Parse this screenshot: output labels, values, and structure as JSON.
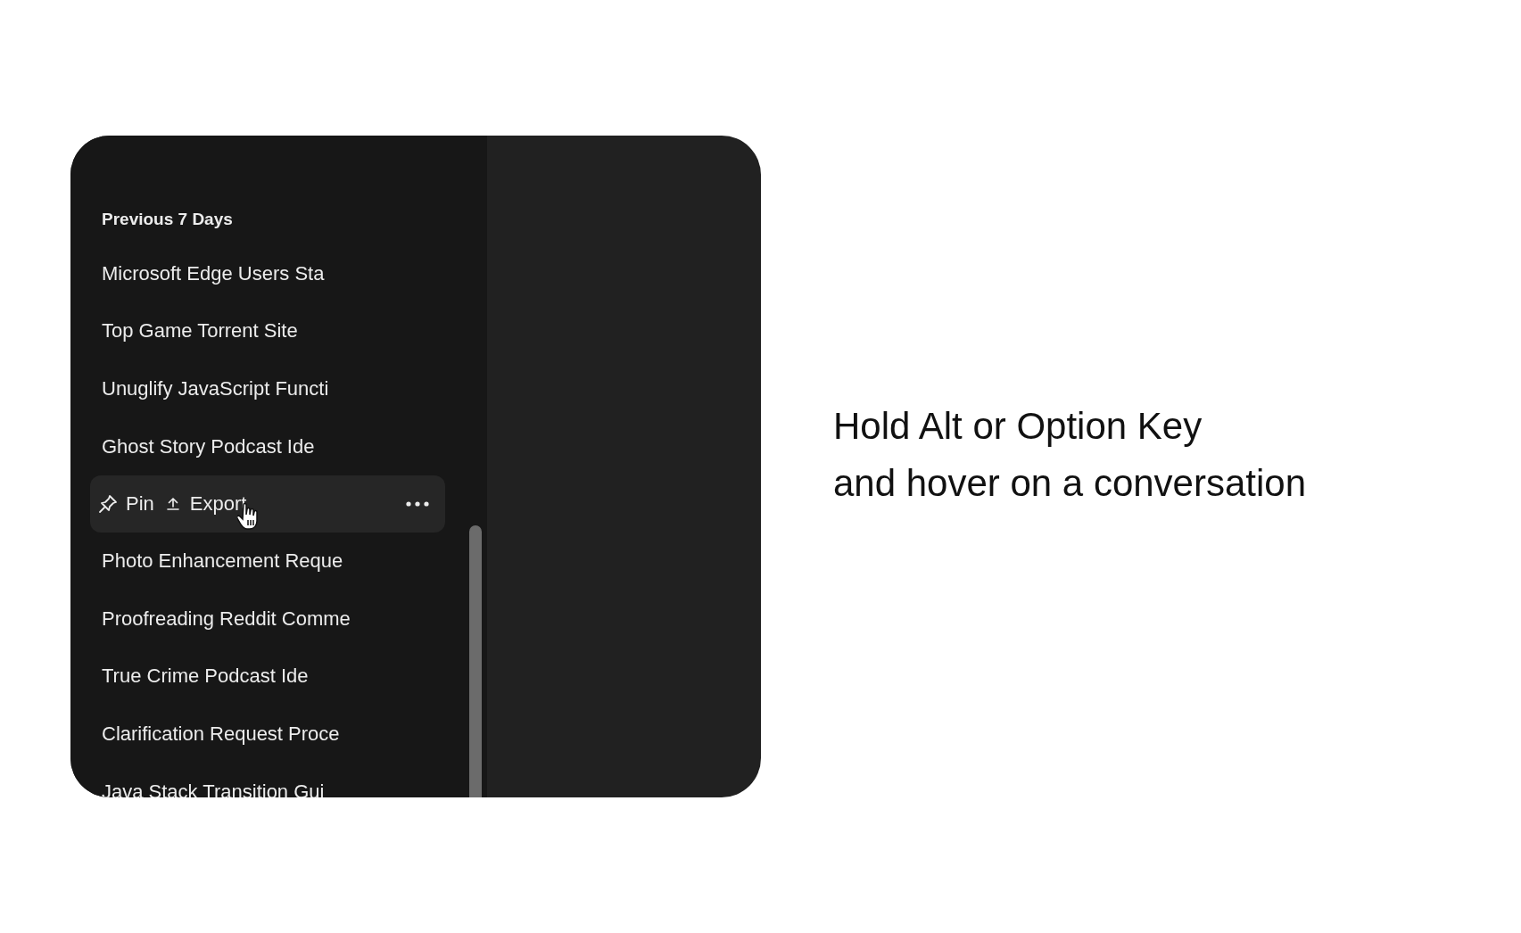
{
  "sidebar": {
    "section_heading": "Previous 7 Days",
    "items": [
      {
        "kind": "title",
        "title": "Microsoft Edge Users Sta"
      },
      {
        "kind": "title",
        "title": "Top Game Torrent Site"
      },
      {
        "kind": "title",
        "title": "Unuglify JavaScript Functi"
      },
      {
        "kind": "title",
        "title": "Ghost Story Podcast Ide"
      },
      {
        "kind": "actions",
        "pin": "Pin",
        "export": "Export"
      },
      {
        "kind": "title",
        "title": "Photo Enhancement Reque"
      },
      {
        "kind": "title",
        "title": "Proofreading Reddit Comme"
      },
      {
        "kind": "title",
        "title": "True Crime Podcast Ide"
      },
      {
        "kind": "title",
        "title": "Clarification Request Proce"
      },
      {
        "kind": "title",
        "title": "Java Stack Transition Gui"
      }
    ]
  },
  "caption": [
    "Hold Alt or Option Key",
    "and hover on a conversation"
  ]
}
